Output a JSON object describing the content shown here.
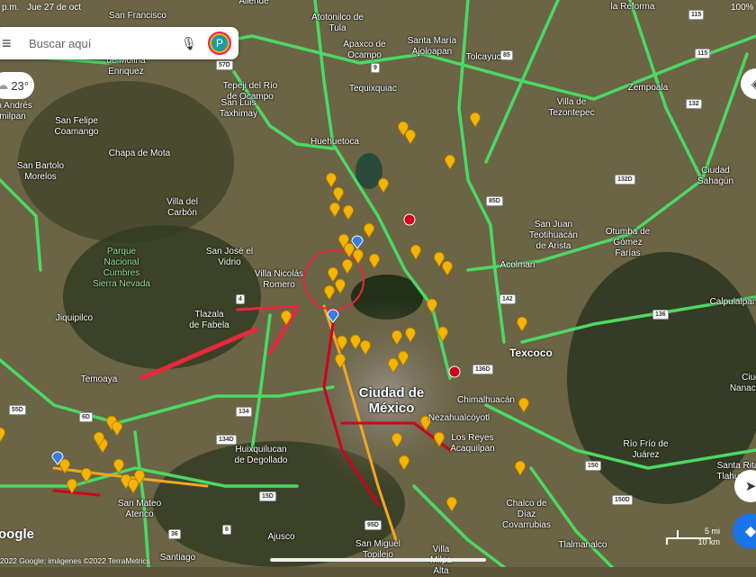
{
  "status_bar": {
    "time_suffix": "p.m.",
    "date": "Jue 27 de oct",
    "battery": "100%"
  },
  "search": {
    "placeholder": "Buscar aquí",
    "avatar_letter": "P"
  },
  "weather": {
    "temperature": "23°"
  },
  "scale": {
    "miles": "5 mi",
    "km": "10 km"
  },
  "attribution": {
    "logo": "oogle",
    "copyright": "2022 Google: imágenes ©2022 TerraMetrics"
  },
  "places": [
    "San Francisco",
    "de Molina Enriquez",
    "Allende",
    "Atotonilco de Tula",
    "Apaxco de Ocampo",
    "Santa María Ajoloapan",
    "Tolcayuca",
    "la Reforma",
    "Zempoala",
    "Tepeji del Río de Ocampo",
    "Tequixquiac",
    "Villa de Tezontepec",
    "San Andrés Timilpan",
    "San Felipe Coamango",
    "San Luis Taxhimay",
    "Huehuetoca",
    "Chapa de Mota",
    "San Bartolo Morelos",
    "Ciudad Sahagún",
    "Villa del Carbón",
    "San Juan Teotihuacán de Arista",
    "Otumba de Gómez Farías",
    "San José el Vidrio",
    "Parque Nacional Cumbres Sierra Nevada",
    "Villa Nicolás Romero",
    "Acolman",
    "Tlazala de Fabela",
    "Jiquipilco",
    "Calpulalpan",
    "Texcoco",
    "Temoaya",
    "Ciudad de México",
    "Chimalhuacán",
    "Nezahualcóyotl",
    "Los Reyes Acaquilpan",
    "Río Frío de Juárez",
    "Santa Rita Tlahuapan",
    "Huixquilucan de Degollado",
    "San Mateo Atenco",
    "Chalco de Díaz Covarrubias",
    "Ajusco",
    "Santiago",
    "San Miguel Topilejo",
    "Tlalmanalco",
    "Villa Milpa Alta",
    "Ciudad Nanacamilpa"
  ],
  "shields": [
    "57D",
    "85",
    "115",
    "115",
    "132",
    "132D",
    "85D",
    "142",
    "136",
    "136D",
    "150D",
    "150",
    "95D",
    "15D",
    "134",
    "134D",
    "55D",
    "36",
    "6",
    "4",
    "9",
    "6D"
  ],
  "colors": {
    "traffic_fast": "#4cd964",
    "traffic_slow": "#f5a623",
    "traffic_jam": "#d0021b",
    "pin": "#f4b400",
    "annotation": "#e8283c"
  }
}
